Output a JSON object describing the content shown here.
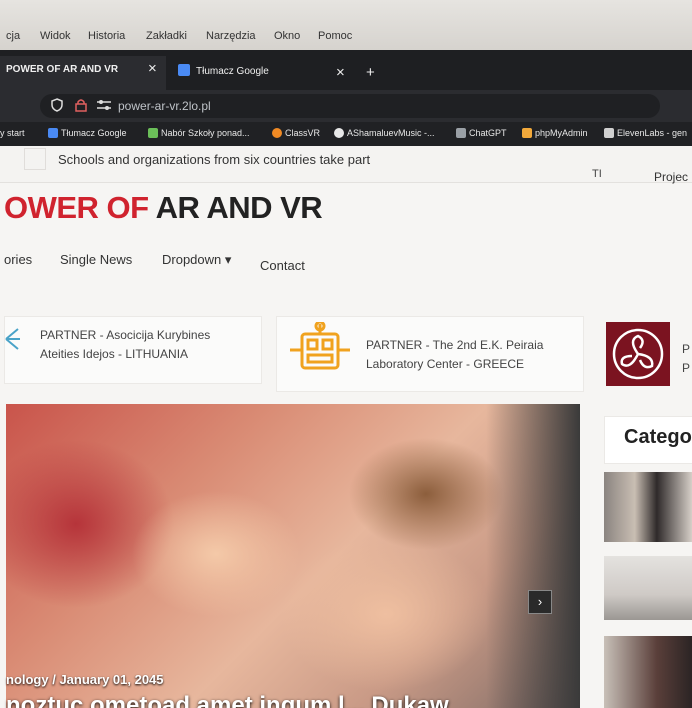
{
  "menu": {
    "items": [
      "cja",
      "Widok",
      "Historia",
      "Zakładki",
      "Narzędzia",
      "Okno",
      "Pomoc"
    ]
  },
  "tabs": [
    {
      "label": "POWER OF AR AND VR",
      "close": "×"
    },
    {
      "label": "Tłumacz Google",
      "close": "×"
    }
  ],
  "new_tab": "+",
  "address": {
    "url": "power-ar-vr.2lo.pl"
  },
  "bookmarks": [
    "y start",
    "Tłumacz Google",
    "Nabór Szkoły ponad...",
    "ClassVR",
    "AShamaluevMusic -...",
    "ChatGPT",
    "phpMyAdmin",
    "ElevenLabs - gen"
  ],
  "site": {
    "ticker": "Schools and organizations from six countries take part",
    "ti": "TI",
    "top_link": "Projec",
    "logo_red": "OWER OF",
    "logo_dark": "AR AND VR",
    "nav": [
      "ories",
      "Single News",
      "Dropdown ▾",
      "Contact"
    ],
    "partners": [
      {
        "line1": "PARTNER - Asocicija Kurybines",
        "line2": "Ateities Idejos - LITHUANIA"
      },
      {
        "line1": "PARTNER - The 2nd E.K. Peiraia",
        "line2": "Laboratory Center - GREECE"
      },
      {
        "line1": "P",
        "line2": "P"
      }
    ],
    "hero": {
      "meta": "nology  /  January 01, 2045",
      "headline": "noztuc ometoad amet ingum l...   Dukaw"
    },
    "next": "›",
    "sidebar_title": "Catego"
  }
}
